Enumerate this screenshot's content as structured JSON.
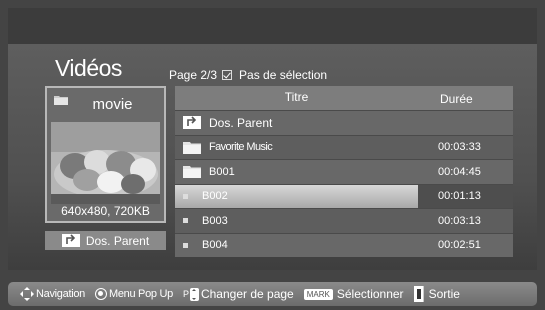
{
  "header": {
    "title": "Vidéos",
    "page": "Page 2/3",
    "selection_status": "Pas de sélection"
  },
  "preview": {
    "label": "movie",
    "dimensions": "640x480, 720KB"
  },
  "parent_button": {
    "label": "Dos. Parent"
  },
  "list": {
    "columns": {
      "title": "Titre",
      "duration": "Durée"
    },
    "rows": [
      {
        "type": "parent-folder",
        "title": "Dos. Parent",
        "duration": ""
      },
      {
        "type": "folder",
        "title": "Favorite Music",
        "duration": "00:03:33"
      },
      {
        "type": "folder",
        "title": "B001",
        "duration": "00:04:45"
      },
      {
        "type": "file",
        "title": "B002",
        "duration": "00:01:13",
        "selected": true
      },
      {
        "type": "file",
        "title": "B003",
        "duration": "00:03:13"
      },
      {
        "type": "file",
        "title": "B004",
        "duration": "00:02:51"
      }
    ]
  },
  "footer": {
    "navigation": "Navigation",
    "menu": "Menu Pop Up",
    "page_key": "P",
    "change_page": "Changer de page",
    "mark_key": "MARK",
    "select": "Sélectionner",
    "exit": "Sortie"
  }
}
